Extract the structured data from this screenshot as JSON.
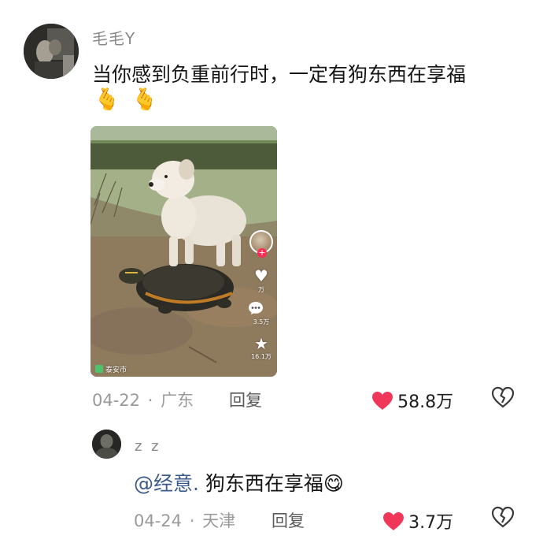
{
  "main_comment": {
    "username": "毛毛Y",
    "text": "当你感到负重前行时，一定有狗东西在享福",
    "emojis": [
      "🫰",
      "🫰"
    ],
    "video": {
      "side_counts": [
        "万",
        "3.5万",
        "16.1万"
      ],
      "tag": "泰安市"
    },
    "date": "04-22",
    "location": "广东",
    "separator": "·",
    "reply_label": "回复",
    "like_count": "58.8万",
    "like_color": "#f0375a"
  },
  "reply": {
    "username": "z z",
    "mention": "@经意.",
    "text": "狗东西在享福",
    "emoji": "😋",
    "date": "04-24",
    "location": "天津",
    "separator": "·",
    "reply_label": "回复",
    "like_count": "3.7万",
    "like_color": "#f0375a"
  },
  "icons": {
    "like": "heart-icon",
    "dislike": "broken-heart-icon",
    "side_like": "heart-icon",
    "side_comment": "comment-icon",
    "side_favorite": "star-icon"
  }
}
